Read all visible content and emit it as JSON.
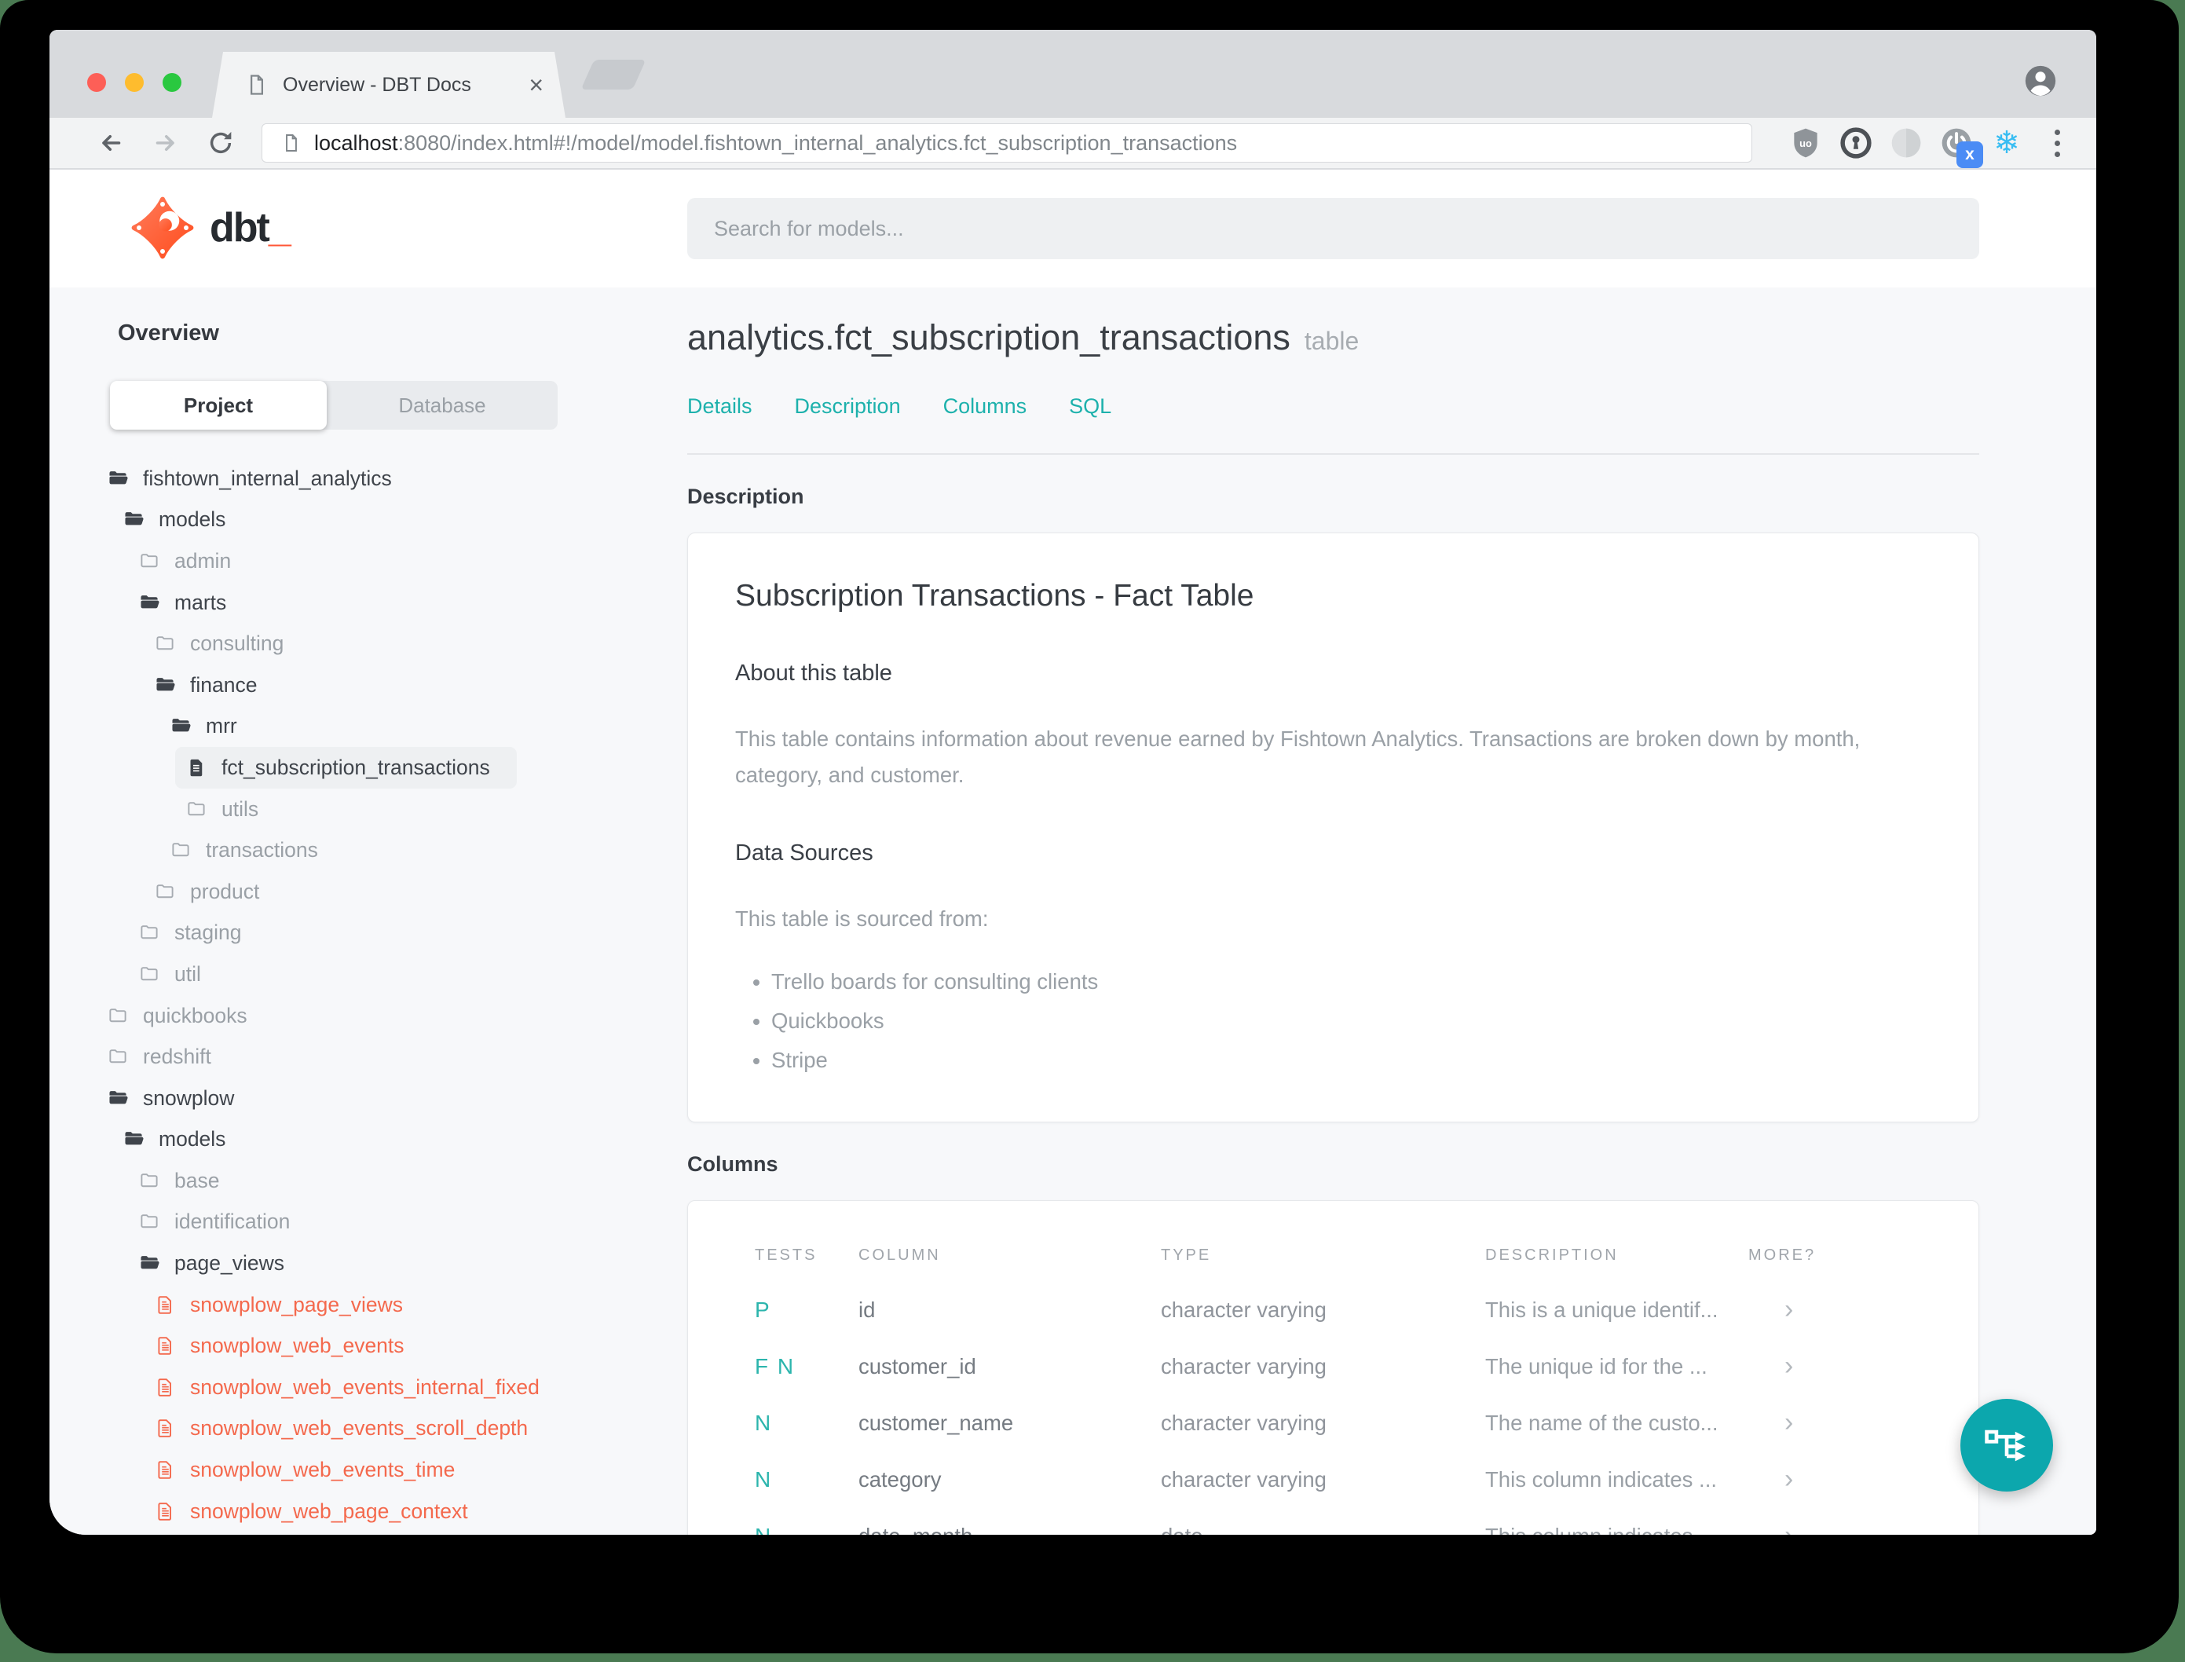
{
  "browser": {
    "tab": {
      "title": "Overview - DBT Docs",
      "close_glyph": "×"
    },
    "url": {
      "host": "localhost",
      "rest": ":8080/index.html#!/model/model.fishtown_internal_analytics.fct_subscription_transactions"
    },
    "extension_badge": "x"
  },
  "header": {
    "logo_text": "dbt",
    "logo_underscore": "_",
    "search_placeholder": "Search for models..."
  },
  "sidebar": {
    "title": "Overview",
    "tabs": {
      "project": "Project",
      "database": "Database",
      "active": "Project"
    },
    "tree": [
      {
        "label": "fishtown_internal_analytics",
        "level": 0,
        "icon": "folder-open",
        "tone": "dark"
      },
      {
        "label": "models",
        "level": 1,
        "icon": "folder-open",
        "tone": "dark"
      },
      {
        "label": "admin",
        "level": 2,
        "icon": "folder",
        "tone": "muted"
      },
      {
        "label": "marts",
        "level": 2,
        "icon": "folder-open",
        "tone": "dark"
      },
      {
        "label": "consulting",
        "level": 3,
        "icon": "folder",
        "tone": "muted"
      },
      {
        "label": "finance",
        "level": 3,
        "icon": "folder-open",
        "tone": "dark"
      },
      {
        "label": "mrr",
        "level": 4,
        "icon": "folder-open",
        "tone": "dark"
      },
      {
        "label": "fct_subscription_transactions",
        "level": 5,
        "icon": "file",
        "tone": "dark",
        "selected": true
      },
      {
        "label": "utils",
        "level": 5,
        "icon": "folder",
        "tone": "muted"
      },
      {
        "label": "transactions",
        "level": 4,
        "icon": "folder",
        "tone": "muted"
      },
      {
        "label": "product",
        "level": 3,
        "icon": "folder",
        "tone": "muted"
      },
      {
        "label": "staging",
        "level": 2,
        "icon": "folder",
        "tone": "muted"
      },
      {
        "label": "util",
        "level": 2,
        "icon": "folder",
        "tone": "muted"
      },
      {
        "label": "quickbooks",
        "level": 0,
        "icon": "folder",
        "tone": "muted"
      },
      {
        "label": "redshift",
        "level": 0,
        "icon": "folder",
        "tone": "muted"
      },
      {
        "label": "snowplow",
        "level": 0,
        "icon": "folder-open",
        "tone": "dark"
      },
      {
        "label": "models",
        "level": 1,
        "icon": "folder-open",
        "tone": "dark"
      },
      {
        "label": "base",
        "level": 2,
        "icon": "folder",
        "tone": "muted"
      },
      {
        "label": "identification",
        "level": 2,
        "icon": "folder",
        "tone": "muted"
      },
      {
        "label": "page_views",
        "level": 2,
        "icon": "folder-open",
        "tone": "dark"
      },
      {
        "label": "snowplow_page_views",
        "level": 3,
        "icon": "file-red",
        "tone": "red"
      },
      {
        "label": "snowplow_web_events",
        "level": 3,
        "icon": "file-red",
        "tone": "red"
      },
      {
        "label": "snowplow_web_events_internal_fixed",
        "level": 3,
        "icon": "file-red",
        "tone": "red"
      },
      {
        "label": "snowplow_web_events_scroll_depth",
        "level": 3,
        "icon": "file-red",
        "tone": "red"
      },
      {
        "label": "snowplow_web_events_time",
        "level": 3,
        "icon": "file-red",
        "tone": "red"
      },
      {
        "label": "snowplow_web_page_context",
        "level": 3,
        "icon": "file-red",
        "tone": "red"
      }
    ]
  },
  "model": {
    "title": "analytics.fct_subscription_transactions",
    "badge": "table",
    "nav": [
      "Details",
      "Description",
      "Columns",
      "SQL"
    ]
  },
  "description_section": {
    "heading": "Description",
    "card": {
      "title": "Subscription Transactions - Fact Table",
      "about_heading": "About this table",
      "about_text": "This table contains information about revenue earned by Fishtown Analytics. Transactions are broken down by month, category, and customer.",
      "sources_heading": "Data Sources",
      "sources_intro": "This table is sourced from:",
      "sources": [
        "Trello boards for consulting clients",
        "Quickbooks",
        "Stripe"
      ]
    }
  },
  "columns_section": {
    "heading": "Columns",
    "table": {
      "headers": [
        "TESTS",
        "COLUMN",
        "TYPE",
        "DESCRIPTION",
        "MORE?"
      ],
      "rows": [
        {
          "tests": "P",
          "column": "id",
          "type": "character varying",
          "description": "This is a unique identif...",
          "more": "›"
        },
        {
          "tests": "F N",
          "column": "customer_id",
          "type": "character varying",
          "description": "The unique id for the ...",
          "more": "›"
        },
        {
          "tests": "N",
          "column": "customer_name",
          "type": "character varying",
          "description": "The name of the custo...",
          "more": "›"
        },
        {
          "tests": "N",
          "column": "category",
          "type": "character varying",
          "description": "This column indicates ...",
          "more": "›"
        },
        {
          "tests": "N",
          "column": "date_month",
          "type": "date",
          "description": "This column indicates ...",
          "more": "›"
        }
      ]
    }
  },
  "colors": {
    "accent": "#1db1ac",
    "fab": "#0ca7ad",
    "model_red": "#f4694d",
    "desktop_green": "#4a7a52",
    "badge_blue": "#4b8cf5",
    "snowflake_blue": "#38bdf2"
  }
}
